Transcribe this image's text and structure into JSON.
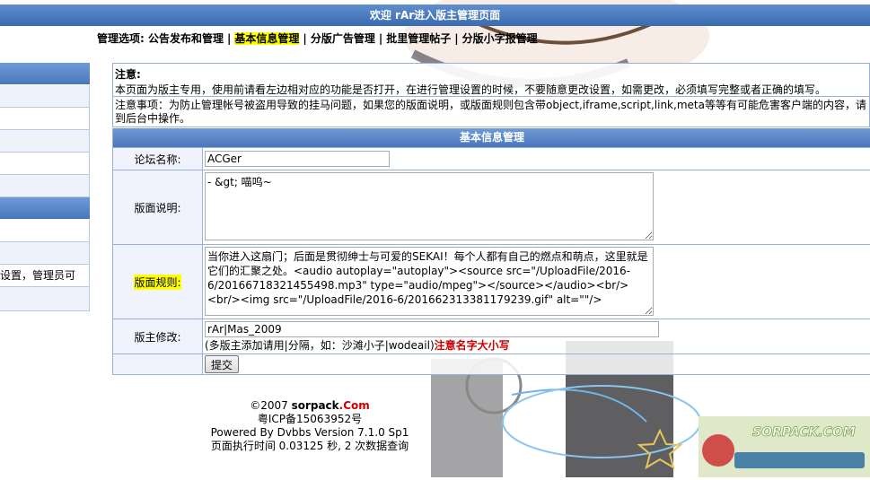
{
  "header": {
    "title": "欢迎 rAr进入版主管理页面"
  },
  "nav": {
    "prefix": "管理选项:",
    "items": [
      {
        "label": "公告发布和管理",
        "active": false
      },
      {
        "label": "基本信息管理",
        "active": true
      },
      {
        "label": "分版广告管理",
        "active": false
      },
      {
        "label": "批里管理帖子",
        "active": false
      },
      {
        "label": "分版小字报管理",
        "active": false
      }
    ],
    "separator": "|"
  },
  "sidebar": {
    "partial_text": "设置，管理员可"
  },
  "notice": {
    "title": "注意:",
    "line1": "本页面为版主专用，使用前请看左边相对应的功能是否打开，在进行管理设置的时候，不要随意更改设置，如需更改，必须填写完整或者正确的填写。",
    "line2": "注意事项：为防止管理帐号被盗用导致的挂马问题，如果您的版面说明，或版面规则包含带object,iframe,script,link,meta等等有可能危害客户端的内容，请到后台中操作。"
  },
  "form": {
    "heading": "基本信息管理",
    "forum_name": {
      "label": "论坛名称:",
      "value": "ACGer"
    },
    "forum_desc": {
      "label": "版面说明:",
      "value": "- &gt; 喵呜~"
    },
    "forum_rules": {
      "label": "版面规则:",
      "value": "当你进入这扇门；后面是贯彻绅士与可爱的SEKAI！每个人都有自己的燃点和萌点，这里就是它们的汇聚之处。<audio autoplay=\"autoplay\"><source src=\"/UploadFile/2016-6/20166718321455498.mp3\" type=\"audio/mpeg\"></source></audio><br/><br/><img src=\"/UploadFile/2016-6/201662313381179239.gif\" alt=\"\"/>"
    },
    "moderators": {
      "label": "版主修改:",
      "value": "rAr|Mas_2009",
      "hint": "(多版主添加请用|分隔，如：沙滩小子|wodeail)",
      "hint_red": "注意名字大小写"
    },
    "submit_label": "提交"
  },
  "footer": {
    "copyright_prefix": "©2007 ",
    "brand": "sorpack",
    "brand_suffix": ".Com",
    "icp": "粤ICP备15063952号",
    "powered": "Powered By Dvbbs Version 7.1.0 Sp1",
    "exec": "页面执行时间 0.03125 秒, 2 次数据查询"
  },
  "logo": {
    "text": "SORPACK.COM"
  },
  "colors": {
    "header_blue": "#4a77bb",
    "highlight": "#ffff00",
    "warning_red": "#cc0000"
  }
}
